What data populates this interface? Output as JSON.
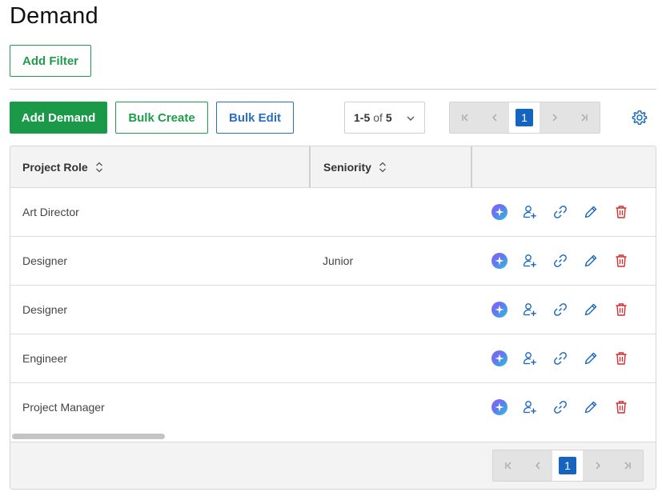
{
  "page": {
    "title": "Demand"
  },
  "filters": {
    "add_filter_label": "Add Filter"
  },
  "toolbar": {
    "add_demand_label": "Add Demand",
    "bulk_create_label": "Bulk Create",
    "bulk_edit_label": "Bulk Edit",
    "range": {
      "start_end": "1-5",
      "of_label": "of",
      "total": "5"
    },
    "settings_icon": "gear-icon"
  },
  "pagination": {
    "current_page": "1",
    "icons": [
      "first-page-icon",
      "prev-page-icon",
      "next-page-icon",
      "last-page-icon"
    ]
  },
  "table": {
    "columns": [
      {
        "label": "Project Role",
        "sortable": true
      },
      {
        "label": "Seniority",
        "sortable": true
      },
      {
        "label": "",
        "sortable": false
      }
    ],
    "rows": [
      {
        "role": "Art Director",
        "seniority": ""
      },
      {
        "role": "Designer",
        "seniority": "Junior"
      },
      {
        "role": "Designer",
        "seniority": ""
      },
      {
        "role": "Engineer",
        "seniority": ""
      },
      {
        "role": "Project Manager",
        "seniority": ""
      }
    ],
    "row_actions": [
      "ai-sparkle-icon",
      "assign-person-icon",
      "link-icon",
      "edit-pencil-icon",
      "delete-trash-icon"
    ]
  },
  "colors": {
    "primary_green": "#1a9a48",
    "primary_blue": "#1565c0",
    "action_blue": "#2a6fbf",
    "danger_red": "#d32f2f"
  }
}
